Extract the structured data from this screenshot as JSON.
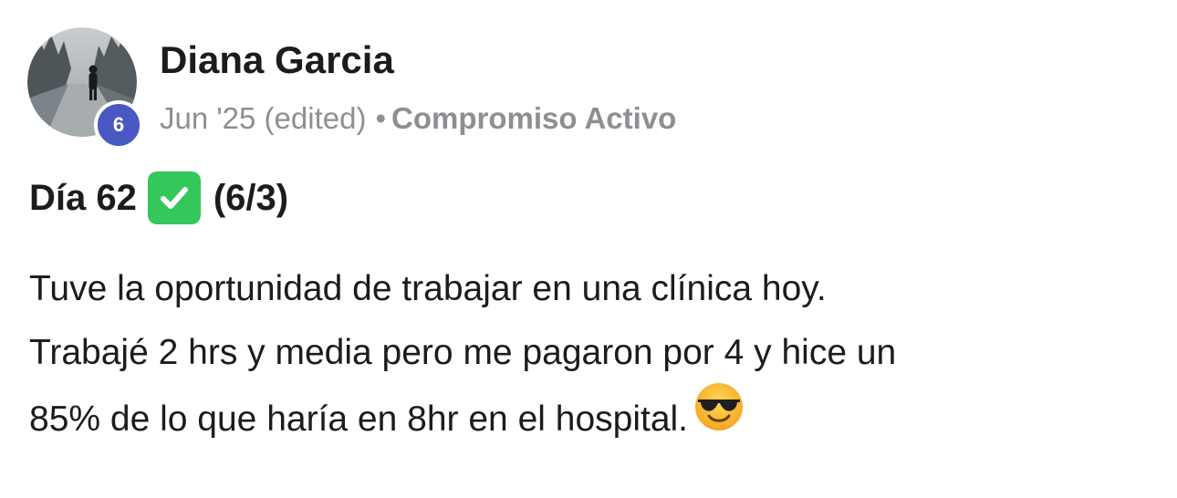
{
  "post": {
    "author_name": "Diana Garcia",
    "level": "6",
    "timestamp": "Jun '25 (edited)",
    "separator": "•",
    "category": "Compromiso Activo",
    "title_prefix": "Día 62",
    "title_suffix": "(6/3)",
    "body_lines": [
      "Tuve la oportunidad de trabajar en una clínica hoy.",
      "Trabajé 2 hrs y media pero me pagaron por 4 y hice un",
      "85% de lo que haría en 8hr en el hospital."
    ],
    "icons": {
      "title_icon": "check-mark-button-icon",
      "body_icon": "smiling-face-with-sunglasses-icon",
      "avatar": "profile-photo"
    },
    "colors": {
      "badge": "#4a58c4",
      "check": "#34c759",
      "meta_text": "#8e8e93",
      "text": "#1c1c1e"
    }
  }
}
